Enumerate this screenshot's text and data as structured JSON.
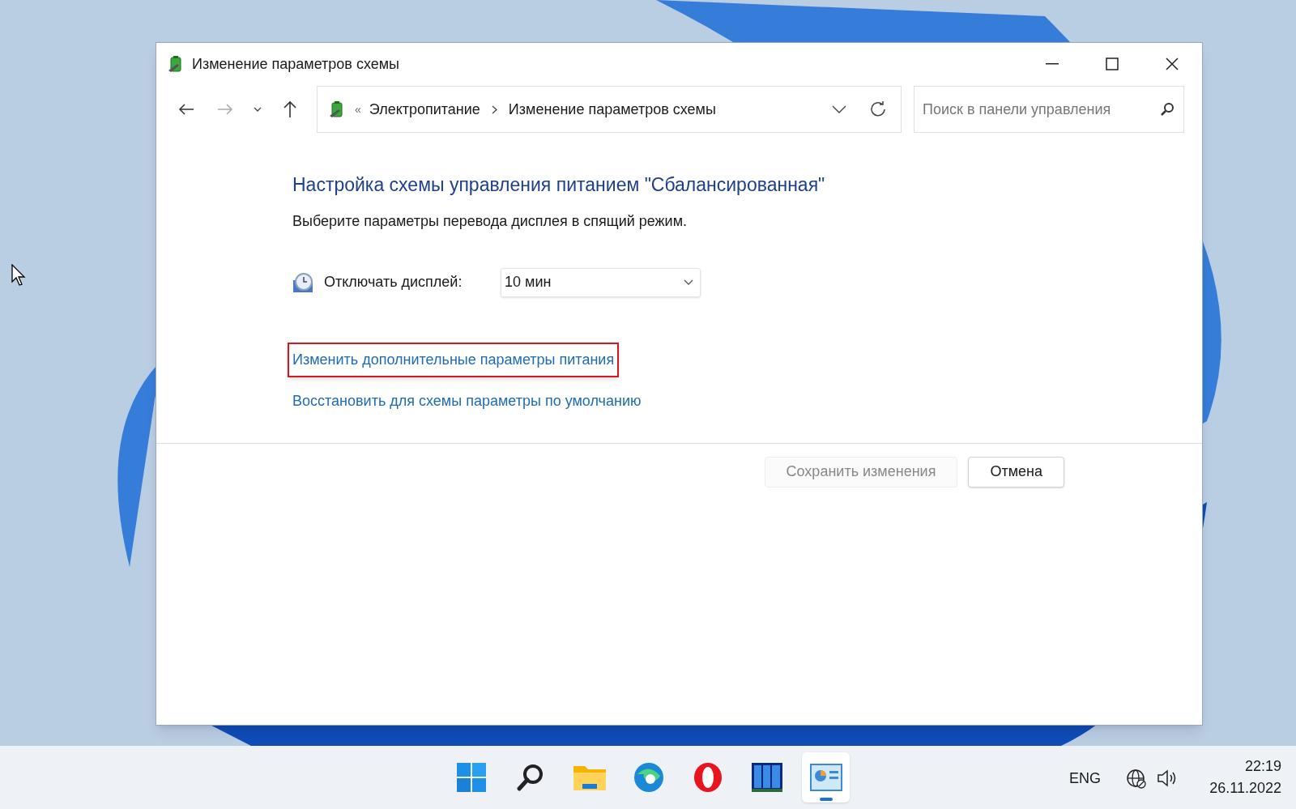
{
  "window": {
    "title": "Изменение параметров схемы"
  },
  "address_bar": {
    "overflow_mark": "«",
    "breadcrumb": [
      "Электропитание",
      "Изменение параметров схемы"
    ]
  },
  "search": {
    "placeholder": "Поиск в панели управления"
  },
  "heading": "Настройка схемы управления питанием \"Сбалансированная\"",
  "description": "Выберите параметры перевода дисплея в спящий режим.",
  "settings": [
    {
      "label": "Отключать дисплей:",
      "value": "10 мин"
    }
  ],
  "links": [
    {
      "text": "Изменить дополнительные параметры питания",
      "highlighted": true
    },
    {
      "text": "Восстановить для схемы параметры по умолчанию",
      "highlighted": false
    }
  ],
  "buttons": [
    {
      "label": "Сохранить изменения",
      "disabled": true
    },
    {
      "label": "Отмена",
      "disabled": false
    }
  ],
  "taskbar": {
    "apps": [
      {
        "kind": "start",
        "selected": false
      },
      {
        "kind": "search",
        "selected": false
      },
      {
        "kind": "folder",
        "selected": false
      },
      {
        "kind": "edge",
        "selected": false
      },
      {
        "kind": "opera",
        "selected": false
      },
      {
        "kind": "panels",
        "selected": false
      },
      {
        "kind": "control-panel",
        "selected": true
      }
    ],
    "language": "ENG",
    "time": "22:19",
    "date": "26.11.2022"
  }
}
